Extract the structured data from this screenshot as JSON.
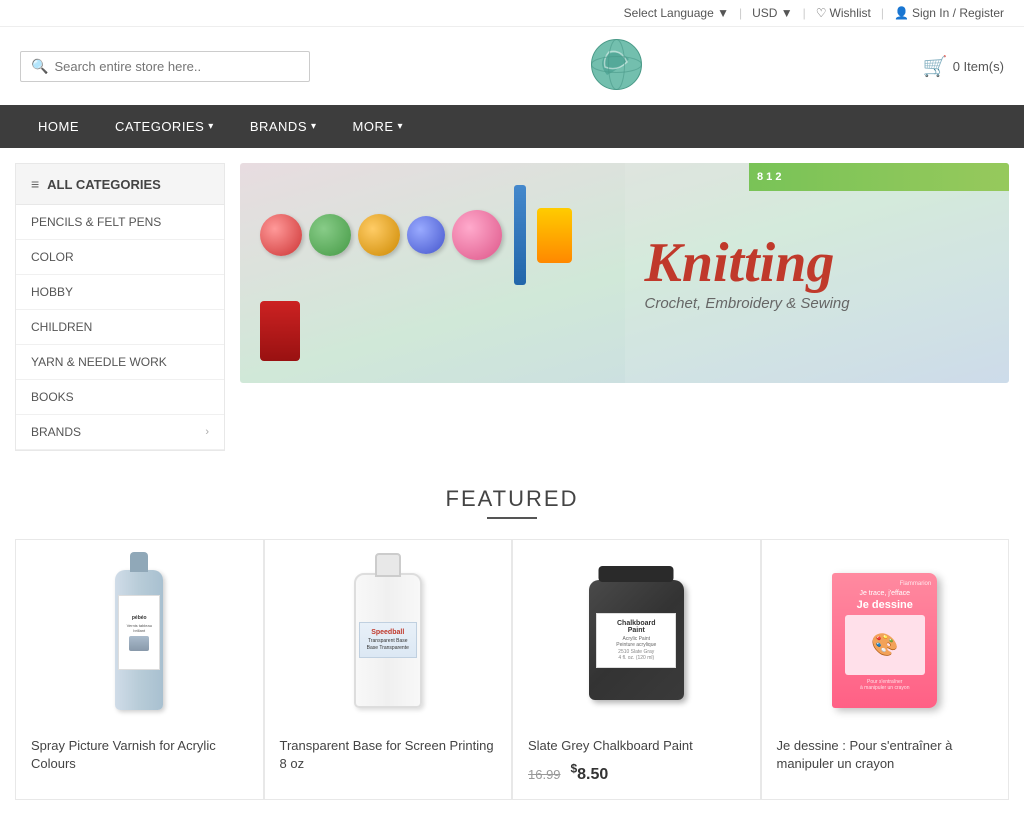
{
  "topbar": {
    "language_label": "Select Language ▼",
    "currency_label": "USD ▼",
    "wishlist_label": "Wishlist",
    "signin_label": "Sign In / Register"
  },
  "header": {
    "search_placeholder": "Search entire store here..",
    "cart_label": "0 Item(s)"
  },
  "nav": {
    "home": "HOME",
    "categories": "CATEGORIES",
    "brands": "BRANDS",
    "more": "MORE"
  },
  "sidebar": {
    "title": "ALL CATEGORIES",
    "items": [
      {
        "label": "PENCILS & FELT PENS",
        "has_arrow": false
      },
      {
        "label": "COLOR",
        "has_arrow": false
      },
      {
        "label": "HOBBY",
        "has_arrow": false
      },
      {
        "label": "CHILDREN",
        "has_arrow": false
      },
      {
        "label": "YARN & NEEDLE WORK",
        "has_arrow": false
      },
      {
        "label": "BOOKS",
        "has_arrow": false
      },
      {
        "label": "BRANDS",
        "has_arrow": true
      }
    ]
  },
  "banner": {
    "title": "Knitting",
    "subtitle": "Crochet, Embroidery & Sewing"
  },
  "featured": {
    "section_title": "FEATURED",
    "products": [
      {
        "name": "Spray Picture Varnish for Acrylic Colours",
        "price_original": null,
        "price_sale": null,
        "id": "spray-varnish"
      },
      {
        "name": "Transparent Base for Screen Printing 8 oz",
        "price_original": null,
        "price_sale": null,
        "id": "transparent-base"
      },
      {
        "name": "Slate Grey Chalkboard Paint",
        "price_original": "16.99",
        "price_sale": "8.50",
        "id": "chalkboard-paint"
      },
      {
        "name": "Je dessine : Pour s'entraîner à manipuler un crayon",
        "price_original": null,
        "price_sale": null,
        "id": "je-dessine-book"
      }
    ]
  }
}
